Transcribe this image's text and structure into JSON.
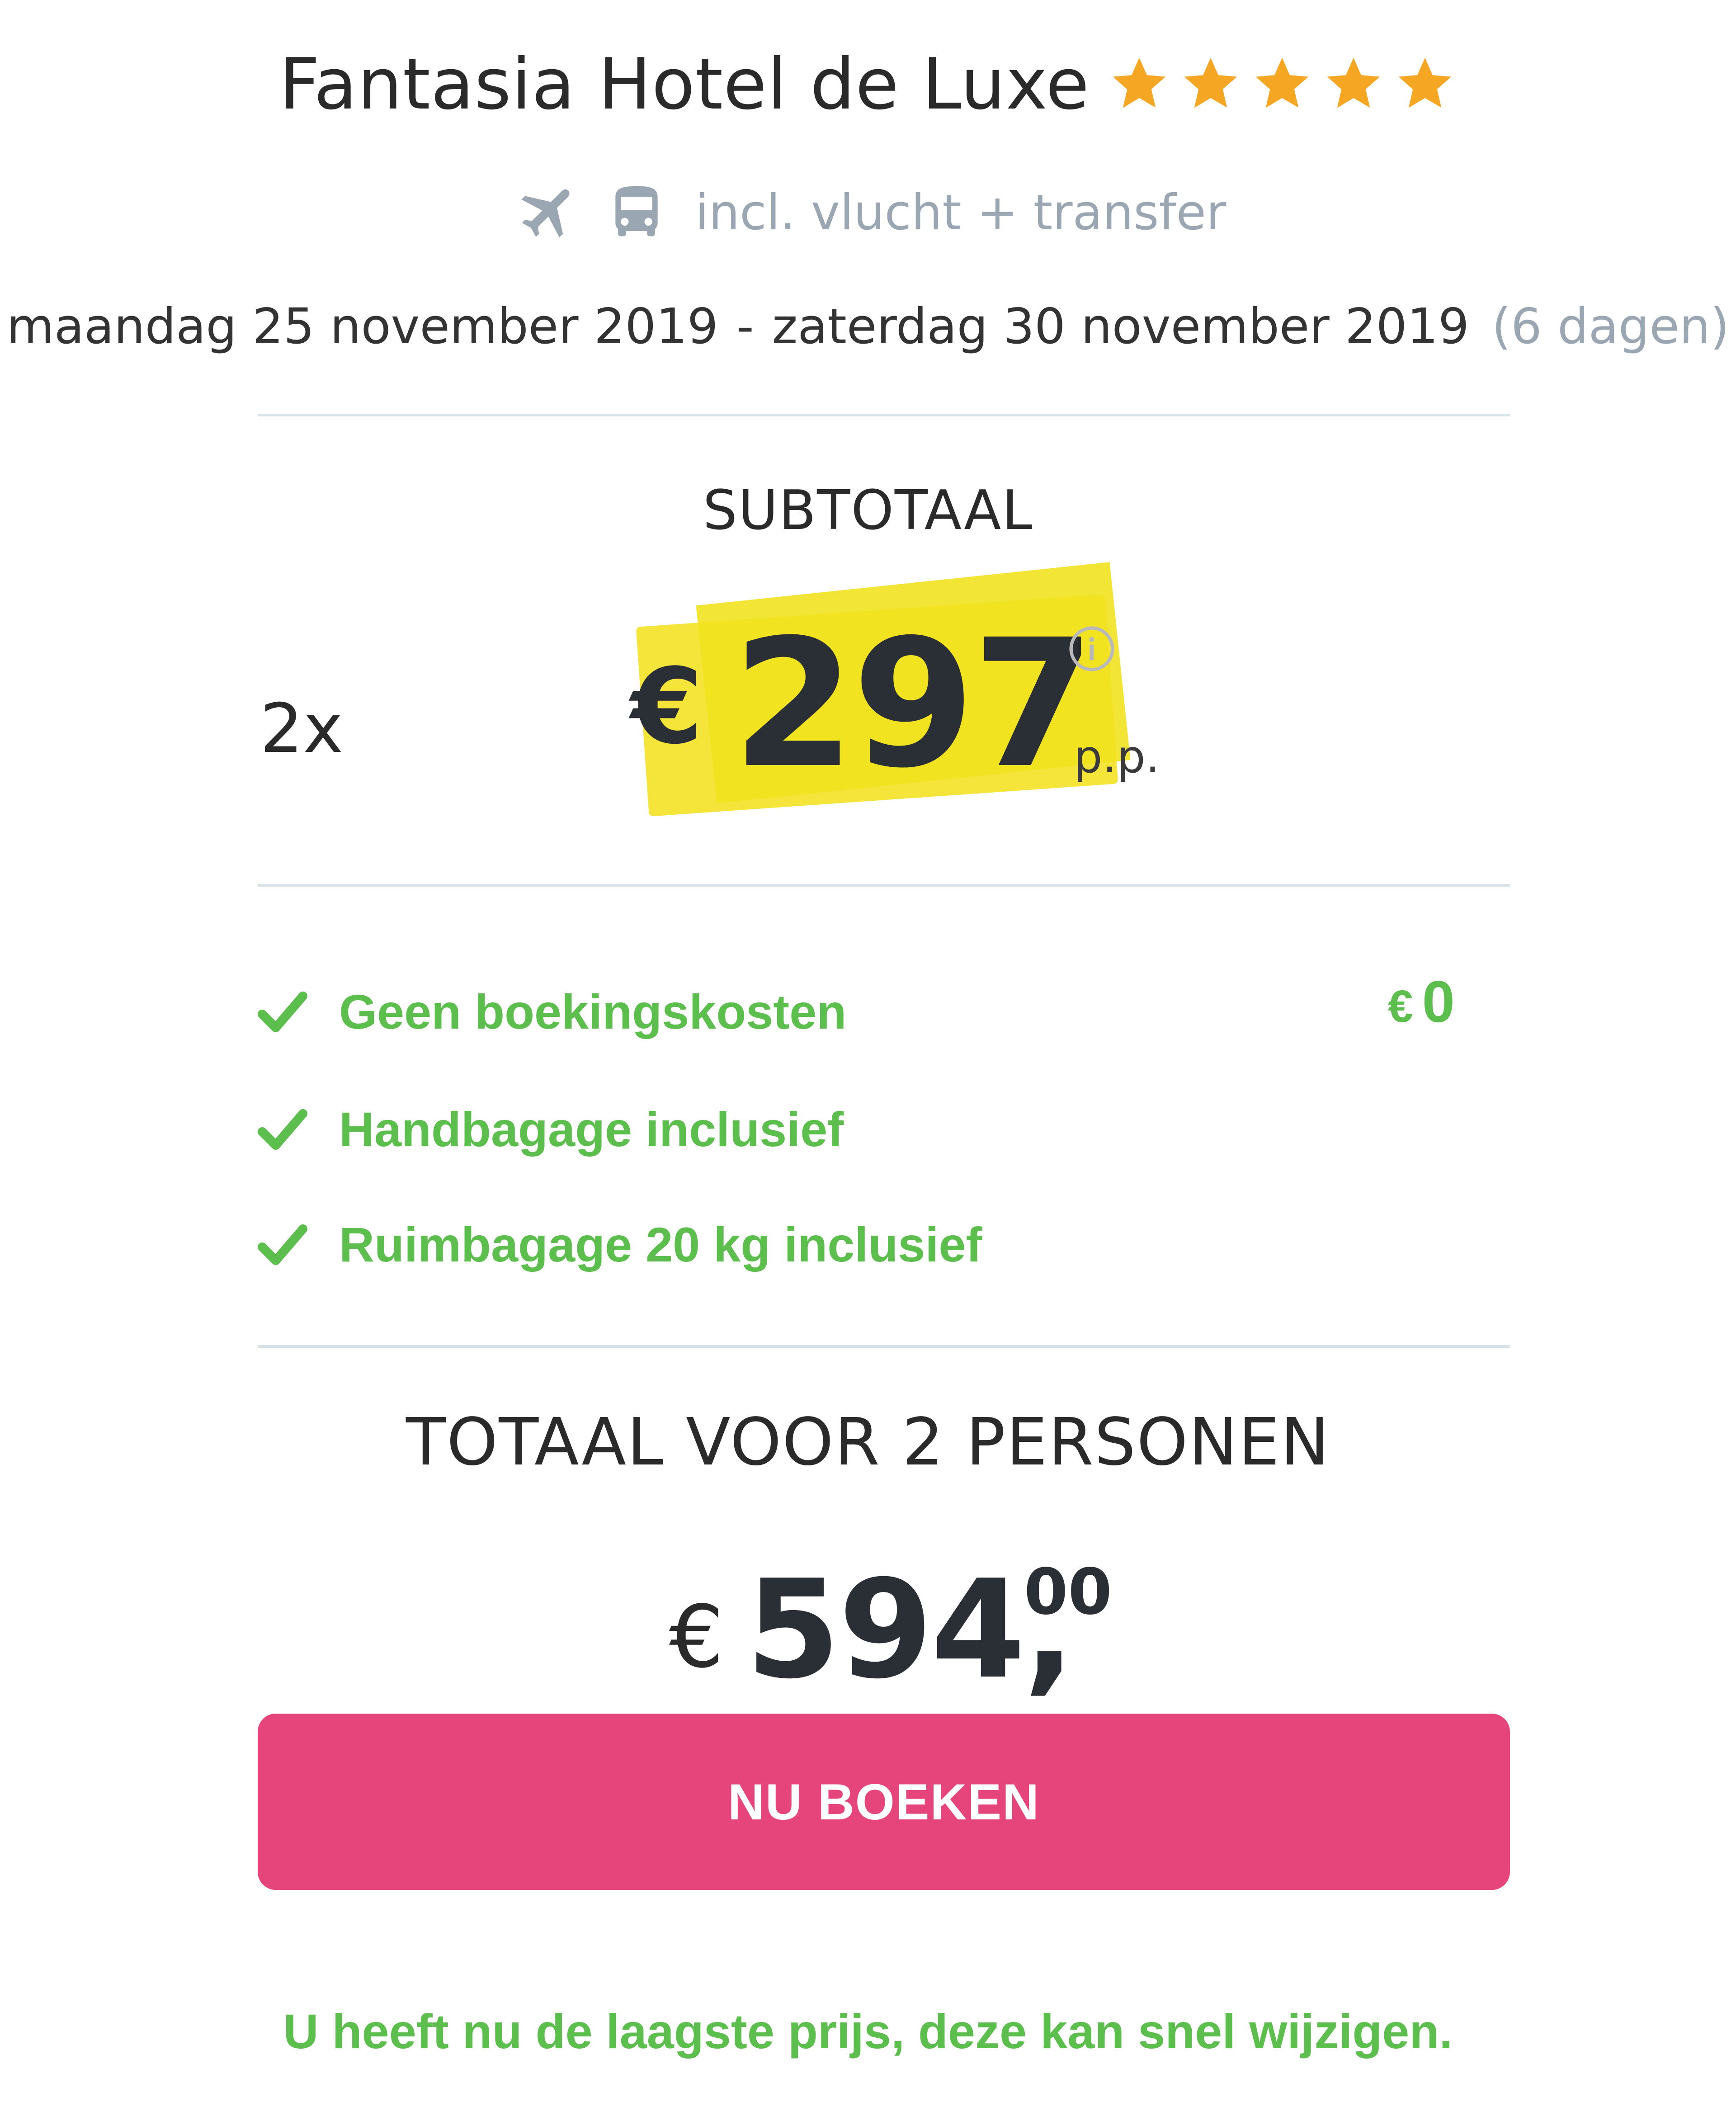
{
  "hotel": {
    "name": "Fantasia Hotel de Luxe",
    "star_rating": 5,
    "star_color": "#f5a623"
  },
  "transport": {
    "icons": [
      "airplane-icon",
      "bus-icon"
    ],
    "label": "incl. vlucht + transfer"
  },
  "dates": {
    "start": "maandag 25 november 2019",
    "separator": "-",
    "end": "zaterdag 30 november 2019",
    "duration": "(6 dagen)"
  },
  "subtotal": {
    "label": "SUBTOTAAL",
    "quantity": "2x",
    "currency": "€",
    "amount": "297",
    "per_person": "p.p.",
    "info_icon": "info-icon",
    "highlight_color": "#f5e53a"
  },
  "features": {
    "items": [
      {
        "icon": "check-icon",
        "label": "Geen boekingskosten"
      },
      {
        "icon": "check-icon",
        "label": "Handbagage inclusief"
      },
      {
        "icon": "check-icon",
        "label": "Ruimbagage 20 kg inclusief"
      }
    ],
    "booking_fee": {
      "currency": "€",
      "value": "0"
    },
    "color": "#5cbe4c"
  },
  "total": {
    "label": "TOTAAL VOOR 2 PERSONEN",
    "currency": "€",
    "amount": "594,",
    "cents": "00"
  },
  "cta": {
    "label": "NU BOEKEN",
    "color": "#e5457a"
  },
  "footer": {
    "note": "U heeft nu de laagste prijs, deze kan snel wijzigen."
  }
}
